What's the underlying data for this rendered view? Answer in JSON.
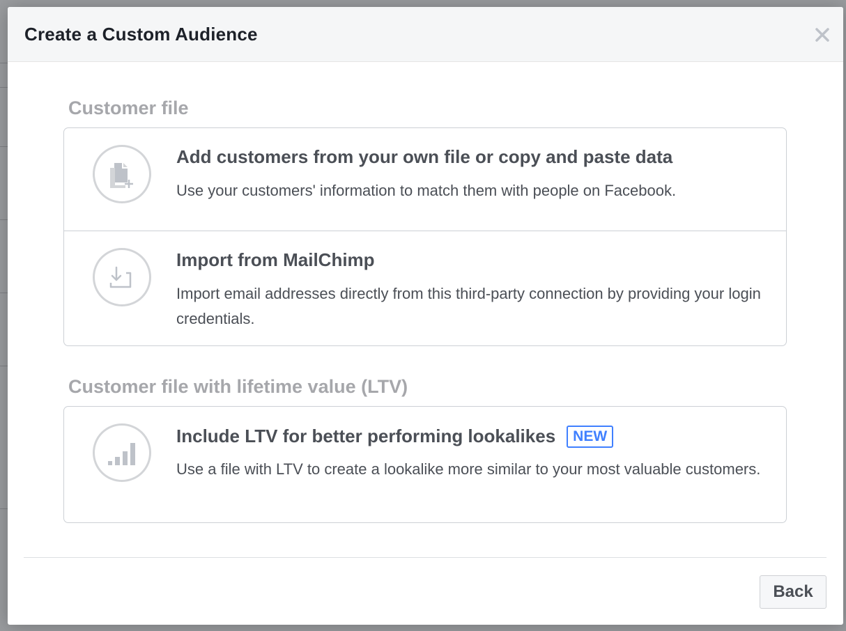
{
  "dialog": {
    "title": "Create a Custom Audience",
    "close_icon": "close-icon"
  },
  "sections": [
    {
      "label": "Customer file",
      "options": [
        {
          "icon": "file-add-icon",
          "title": "Add customers from your own file or copy and paste data",
          "description": "Use your customers' information to match them with people on Facebook."
        },
        {
          "icon": "import-icon",
          "title": "Import from MailChimp",
          "description": "Import email addresses directly from this third-party connection by providing your login credentials."
        }
      ]
    },
    {
      "label": "Customer file with lifetime value (LTV)",
      "options": [
        {
          "icon": "bar-chart-icon",
          "title": "Include LTV for better performing lookalikes",
          "badge": "NEW",
          "description": "Use a file with LTV to create a lookalike more similar to your most valuable customers."
        }
      ]
    }
  ],
  "footer": {
    "back_label": "Back"
  },
  "colors": {
    "title_text": "#1d2129",
    "body_text": "#4b4f56",
    "section_label": "#a6a7ab",
    "badge_blue": "#4080ff",
    "border": "#ccd0d5",
    "icon_gray": "#bec2c9"
  }
}
